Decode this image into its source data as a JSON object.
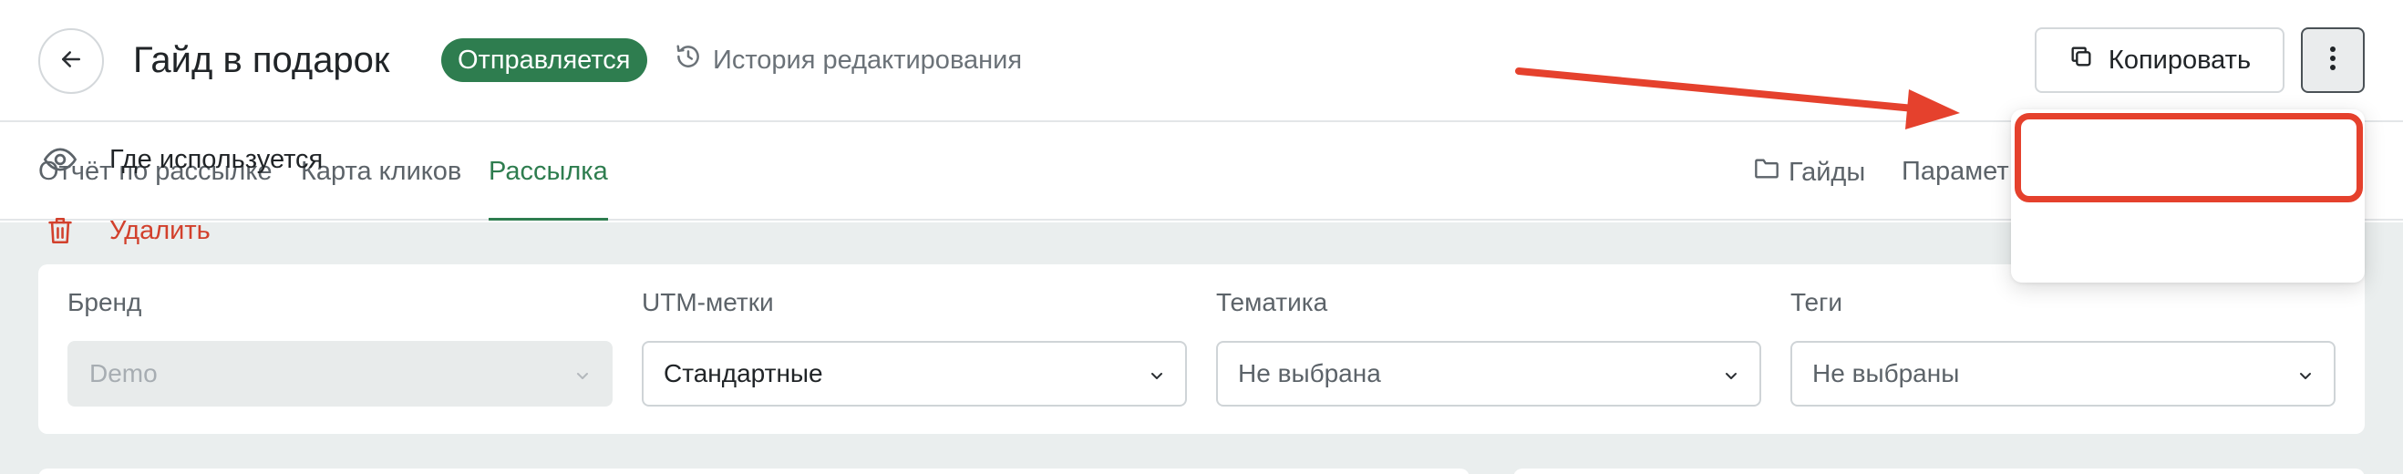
{
  "header": {
    "title": "Гайд в подарок",
    "status": "Отправляется",
    "history_label": "История редактирования",
    "copy_label": "Копировать"
  },
  "tabs": {
    "report": "Отчёт по рассылке",
    "click_map": "Карта кликов",
    "mailing": "Рассылка",
    "guides": "Гайды",
    "params": "Парамет"
  },
  "filters": {
    "brand": {
      "label": "Бренд",
      "value": "Demo"
    },
    "utm": {
      "label": "UTM-метки",
      "value": "Стандартные"
    },
    "topic": {
      "label": "Тематика",
      "value": "Не выбрана"
    },
    "tags": {
      "label": "Теги",
      "value": "Не выбраны"
    }
  },
  "menu": {
    "where_used": "Где используется",
    "delete": "Удалить"
  },
  "colors": {
    "accent_green": "#2e7d4f",
    "danger_red": "#d2402c",
    "annotation_red": "#e5412d"
  },
  "icons": [
    "arrow-left-icon",
    "history-icon",
    "copy-icon",
    "more-vertical-icon",
    "folder-icon",
    "eye-icon",
    "trash-icon",
    "chevron-down-icon"
  ]
}
